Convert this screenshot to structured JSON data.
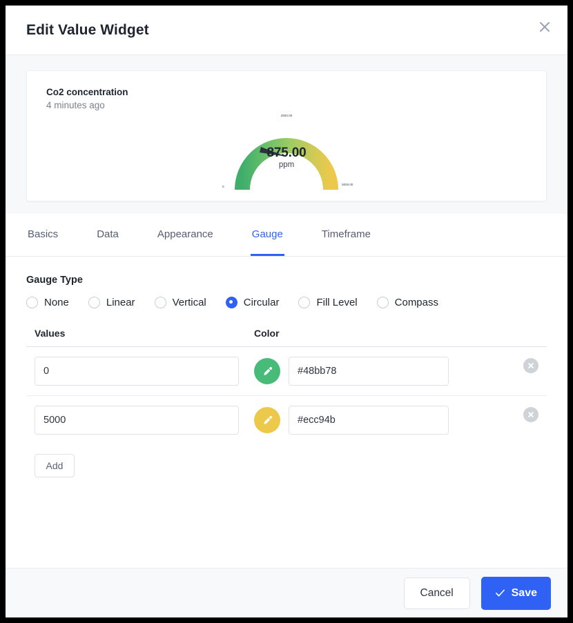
{
  "window": {
    "title": "Edit Value Widget",
    "close_icon": "close-icon"
  },
  "preview": {
    "widget_title": "Co2 concentration",
    "timestamp": "4 minutes ago",
    "gauge": {
      "value": "875.00",
      "unit": "ppm",
      "tick_min": "0",
      "tick_mid": "2500.00",
      "tick_max": "5000.00",
      "min": 0,
      "max": 5000,
      "current": 875,
      "color_start": "#48bb78",
      "color_end": "#ecc94b"
    }
  },
  "tabs": [
    {
      "label": "Basics",
      "active": false
    },
    {
      "label": "Data",
      "active": false
    },
    {
      "label": "Appearance",
      "active": false
    },
    {
      "label": "Gauge",
      "active": true
    },
    {
      "label": "Timeframe",
      "active": false
    }
  ],
  "gauge_type": {
    "label": "Gauge Type",
    "options": [
      {
        "label": "None",
        "selected": false
      },
      {
        "label": "Linear",
        "selected": false
      },
      {
        "label": "Vertical",
        "selected": false
      },
      {
        "label": "Circular",
        "selected": true
      },
      {
        "label": "Fill Level",
        "selected": false
      },
      {
        "label": "Compass",
        "selected": false
      }
    ],
    "accent_color": "#2f62f4"
  },
  "values_table": {
    "header_values": "Values",
    "header_color": "Color",
    "rows": [
      {
        "value": "0",
        "color_hex": "#48bb78",
        "swatch_color": "#48bb78"
      },
      {
        "value": "5000",
        "color_hex": "#ecc94b",
        "swatch_color": "#ecc94b"
      }
    ],
    "add_label": "Add"
  },
  "footer": {
    "cancel_label": "Cancel",
    "save_label": "Save"
  }
}
